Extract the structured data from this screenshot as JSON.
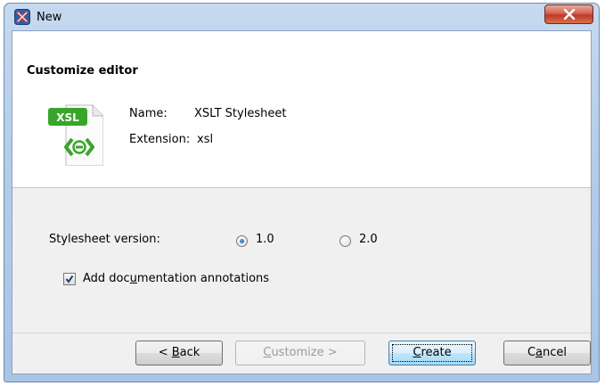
{
  "window": {
    "title": "New"
  },
  "header": {
    "title": "Customize editor",
    "icon_badge": "XSL",
    "name_label": "Name:",
    "name_value": "XSLT Stylesheet",
    "extension_label": "Extension:",
    "extension_value": "xsl"
  },
  "options": {
    "version_label": "Stylesheet version:",
    "versions": [
      {
        "label": "1.0",
        "selected": true
      },
      {
        "label": "2.0",
        "selected": false
      }
    ],
    "annotations_label_pre": "Add doc",
    "annotations_label_u": "u",
    "annotations_label_post": "mentation annotations",
    "annotations_checked": true
  },
  "buttons": {
    "back_pre": "< ",
    "back_u": "B",
    "back_post": "ack",
    "customize_u": "C",
    "customize_post": "ustomize >",
    "create_u": "C",
    "create_post": "reate",
    "cancel_pre": "C",
    "cancel_u": "a",
    "cancel_post": "ncel"
  },
  "colors": {
    "accent": "#3c7fb1",
    "icon_green": "#3aa52b",
    "close_red": "#c0392b"
  }
}
